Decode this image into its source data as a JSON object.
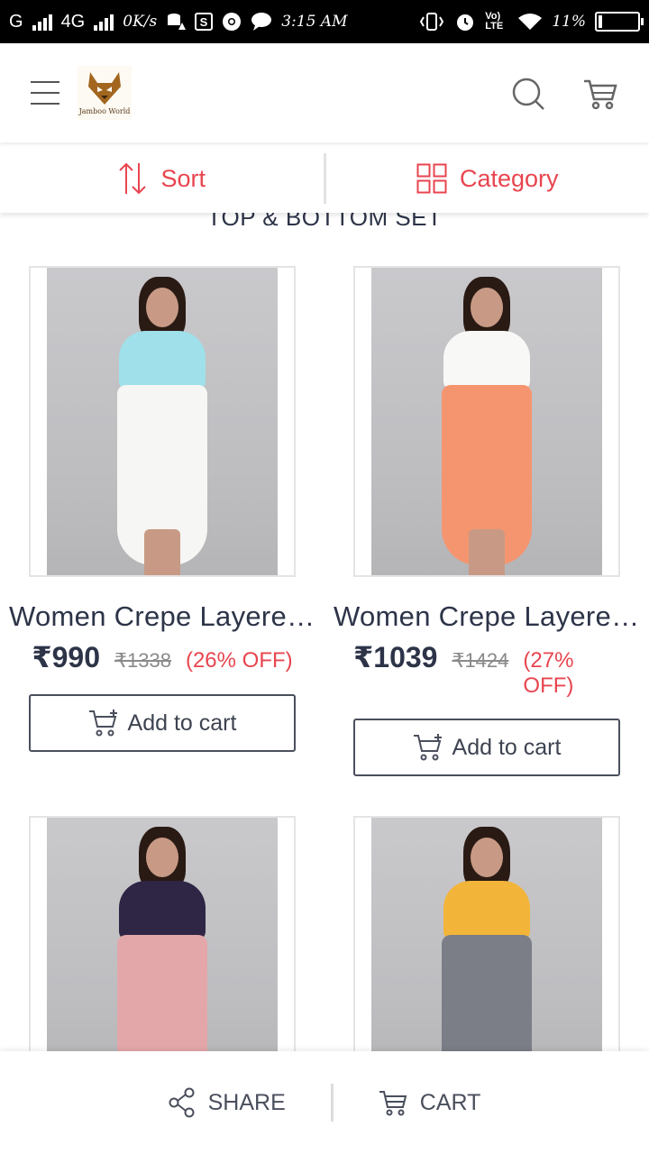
{
  "status_bar": {
    "carrier": "G",
    "network": "4G",
    "speed": "0K/s",
    "time": "3:15 AM",
    "volte": "Vo) LTE",
    "battery": "11%"
  },
  "header": {
    "logo_text": "Jamboo World",
    "menu_icon": "hamburger-menu-icon",
    "search_icon": "search-icon",
    "cart_icon": "cart-icon"
  },
  "filters": {
    "sort_label": "Sort",
    "category_label": "Category"
  },
  "section_title": "TOP & BOTTOM SET",
  "products": [
    {
      "name": "Women Crepe Layered Top & Bottom Set",
      "price": "₹990",
      "mrp": "₹1338",
      "discount": "(26% OFF)",
      "add_label": "Add to cart",
      "top_color": "#9fe0ea",
      "bottom_color": "#f6f6f4"
    },
    {
      "name": "Women Crepe Layered Top & Bottom Set",
      "price": "₹1039",
      "mrp": "₹1424",
      "discount": "(27% OFF)",
      "add_label": "Add to cart",
      "top_color": "#f8f8f6",
      "bottom_color": "#f4956f"
    },
    {
      "name": "",
      "price": "",
      "mrp": "",
      "discount": "",
      "add_label": "",
      "top_color": "#2f2545",
      "bottom_color": "#e3a7a9"
    },
    {
      "name": "",
      "price": "",
      "mrp": "",
      "discount": "",
      "add_label": "",
      "top_color": "#f2b53a",
      "bottom_color": "#7b7e86"
    }
  ],
  "bottom_bar": {
    "share_label": "SHARE",
    "cart_label": "CART"
  },
  "colors": {
    "accent": "#e8454f",
    "text_dark": "#2d3448"
  }
}
